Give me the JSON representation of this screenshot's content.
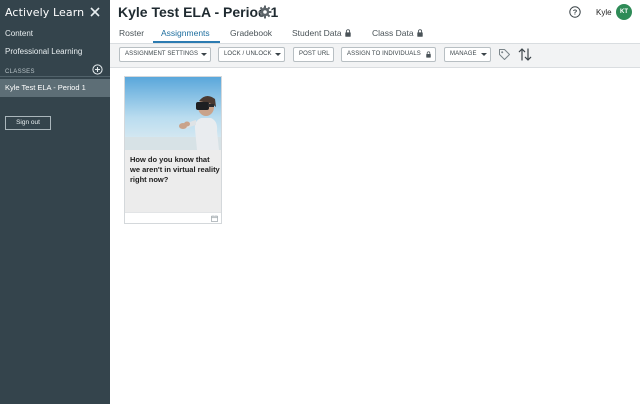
{
  "sidebar": {
    "brand": "Actively Learn",
    "nav": [
      {
        "label": "Content"
      },
      {
        "label": "Professional Learning"
      }
    ],
    "classes_label": "CLASSES",
    "active_class": "Kyle Test ELA - Period 1",
    "signout_label": "Sign out"
  },
  "header": {
    "title": "Kyle Test ELA - Period 1",
    "user_name": "Kyle",
    "avatar_initials": "KT",
    "avatar_color": "#2e8b57"
  },
  "tabs": [
    {
      "label": "Roster"
    },
    {
      "label": "Assignments",
      "active": true
    },
    {
      "label": "Gradebook"
    },
    {
      "label": "Student Data",
      "locked": true
    },
    {
      "label": "Class Data",
      "locked": true
    }
  ],
  "toolbar": {
    "assignment_settings": "ASSIGNMENT SETTINGS",
    "lock_unlock": "LOCK / UNLOCK",
    "post_url": "POST URL",
    "assign_to_individuals": "ASSIGN TO INDIVIDUALS",
    "manage": "MANAGE"
  },
  "assignments": [
    {
      "title": "How do you know that we aren't in virtual reality right now?"
    }
  ],
  "colors": {
    "sidebar": "#34444c",
    "active_tab": "#2b7bb1"
  }
}
